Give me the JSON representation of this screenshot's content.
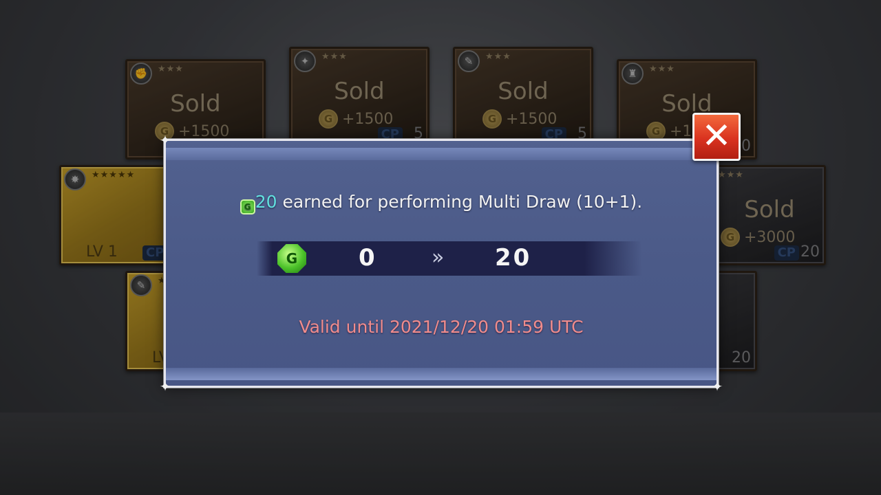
{
  "background_cards": [
    {
      "stars": "★★★",
      "icon": "✊",
      "status": "Sold",
      "price": "+1500",
      "cp": "",
      "cp_value": "",
      "lv": ""
    },
    {
      "stars": "★★★",
      "icon": "✦",
      "status": "Sold",
      "price": "+1500",
      "cp": "CP",
      "cp_value": "5",
      "lv": ""
    },
    {
      "stars": "★★★",
      "icon": "✎",
      "status": "Sold",
      "price": "+1500",
      "cp": "CP",
      "cp_value": "5",
      "lv": ""
    },
    {
      "stars": "★★★",
      "icon": "♜",
      "status": "Sold",
      "price": "+1500",
      "cp": "",
      "cp_value": "0",
      "lv": ""
    },
    {
      "stars": "★★★★★",
      "icon": "✸",
      "status": "",
      "price": "",
      "cp": "CP",
      "cp_value": "",
      "lv": "LV 1"
    },
    {
      "stars": "★★★",
      "icon": "",
      "status": "Sold",
      "price": "+3000",
      "cp": "CP",
      "cp_value": "20",
      "lv": ""
    },
    {
      "stars": "★",
      "icon": "✎",
      "status": "",
      "price": "",
      "cp": "",
      "cp_value": "",
      "lv": "LV"
    },
    {
      "stars": "",
      "icon": "",
      "status": "",
      "price": "",
      "cp": "",
      "cp_value": "20",
      "lv": ""
    }
  ],
  "coin_glyph": "G",
  "modal": {
    "message_amount": "20",
    "message_text": " earned for performing Multi Draw (10+1).",
    "gem_glyph": "G",
    "from_value": "0",
    "arrow": "»",
    "to_value": "20",
    "valid_until": "Valid until 2021/12/20 01:59 UTC"
  },
  "close_button": {
    "glyph": "✕"
  },
  "colors": {
    "modal_bg": "#4b5a88",
    "amount_cyan": "#62e0df",
    "valid_red": "#f08c8c",
    "close_red": "#d9321f",
    "gem_green": "#4cc22a"
  }
}
